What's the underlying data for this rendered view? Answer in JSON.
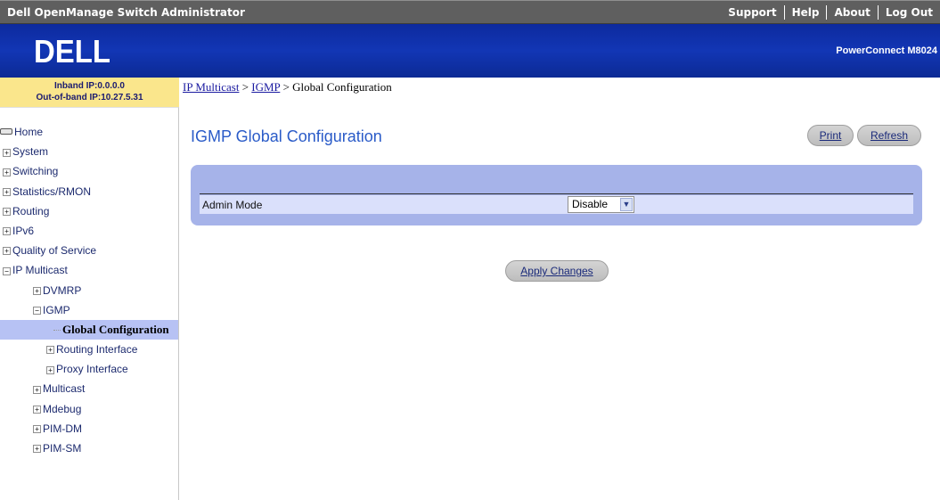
{
  "app": {
    "title": "Dell OpenManage Switch Administrator"
  },
  "toplinks": [
    "Support",
    "Help",
    "About",
    "Log Out"
  ],
  "banner": {
    "logo": "DELL",
    "product": "PowerConnect M8024"
  },
  "ipinfo": {
    "inband": "Inband IP:0.0.0.0",
    "outofband": "Out-of-band IP:10.27.5.31"
  },
  "sidebar": {
    "items": [
      {
        "label": "Home"
      },
      {
        "label": "System"
      },
      {
        "label": "Switching"
      },
      {
        "label": "Statistics/RMON"
      },
      {
        "label": "Routing"
      },
      {
        "label": "IPv6"
      },
      {
        "label": "Quality of Service"
      },
      {
        "label": "IP Multicast"
      },
      {
        "label": "DVMRP"
      },
      {
        "label": "IGMP"
      },
      {
        "label": "Global Configuration"
      },
      {
        "label": "Routing Interface"
      },
      {
        "label": "Proxy Interface"
      },
      {
        "label": "Multicast"
      },
      {
        "label": "Mdebug"
      },
      {
        "label": "PIM-DM"
      },
      {
        "label": "PIM-SM"
      }
    ]
  },
  "breadcrumb": {
    "part1": "IP Multicast",
    "sep": ">",
    "part2": "IGMP",
    "current": "Global Configuration"
  },
  "main": {
    "title": "IGMP Global Configuration",
    "print_label": "Print",
    "refresh_label": "Refresh",
    "admin_mode_label": "Admin Mode",
    "admin_mode_value": "Disable",
    "apply_label": "Apply Changes"
  }
}
